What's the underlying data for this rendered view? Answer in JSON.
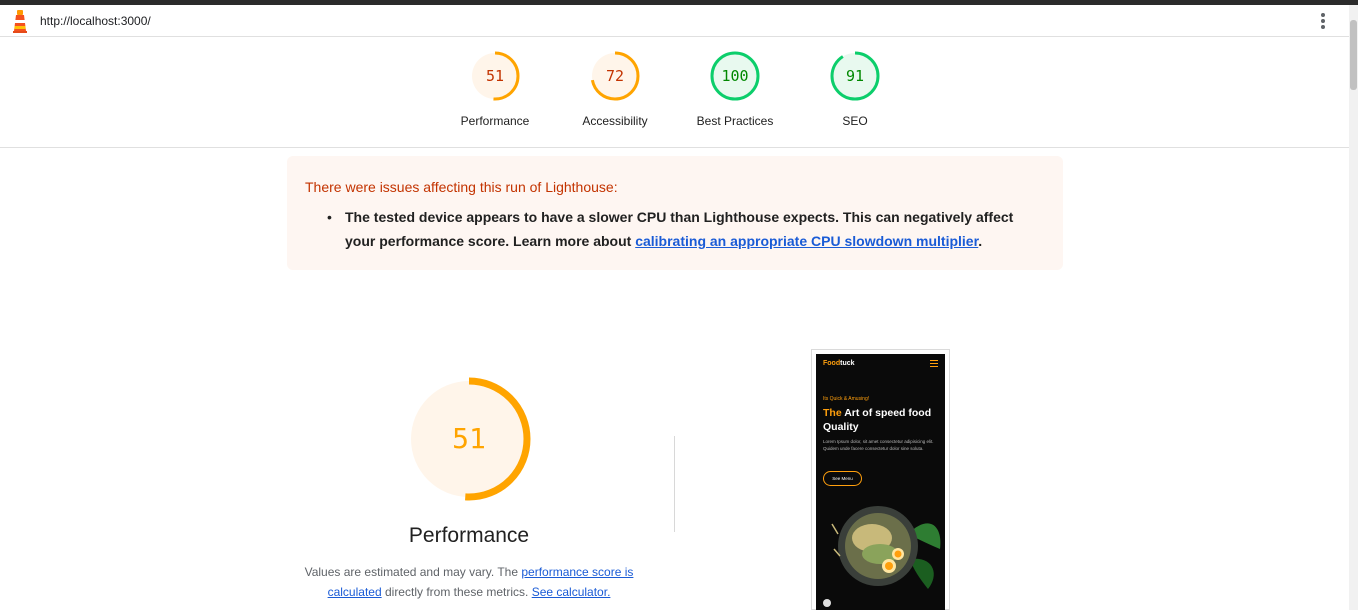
{
  "topbar": {
    "url": "http://localhost:3000/"
  },
  "scores": [
    {
      "label": "Performance",
      "value": "51",
      "fraction": 0.51,
      "color": "#ffa400",
      "bg": "#fff5ea",
      "text": "#c33300"
    },
    {
      "label": "Accessibility",
      "value": "72",
      "fraction": 0.72,
      "color": "#ffa400",
      "bg": "#fff5ea",
      "text": "#c33300"
    },
    {
      "label": "Best Practices",
      "value": "100",
      "fraction": 1.0,
      "color": "#0cce6b",
      "bg": "#e8f9ef",
      "text": "#008800"
    },
    {
      "label": "SEO",
      "value": "91",
      "fraction": 0.91,
      "color": "#0cce6b",
      "bg": "#e8f9ef",
      "text": "#008800"
    }
  ],
  "warning": {
    "title": "There were issues affecting this run of Lighthouse:",
    "item_text": "The tested device appears to have a slower CPU than Lighthouse expects. This can negatively affect your performance score. Learn more about ",
    "item_link": "calibrating an appropriate CPU slowdown multiplier",
    "item_end": "."
  },
  "performance": {
    "score": "51",
    "fraction": 0.51,
    "title": "Performance",
    "desc_1": "Values are estimated and may vary. The ",
    "desc_link_1": "performance score is calculated",
    "desc_2": " directly from these metrics. ",
    "desc_link_2": "See calculator.",
    "color": "#ffa400",
    "text_color": "#ffa400"
  },
  "screenshot": {
    "logo_a": "Food",
    "logo_b": "tuck",
    "kicker": "Its Quick & Amusing!",
    "headline_a": "The",
    "headline_b": " Art of speed food Quality",
    "body": "Lorem Ipsum dolor, sit amet consectetur adipisicing elit. Quidem unde facere consectetur dolor sine soluta.",
    "button": "See Menu"
  },
  "icons": {
    "logo": "lighthouse-icon",
    "menu": "more-vert-icon"
  }
}
